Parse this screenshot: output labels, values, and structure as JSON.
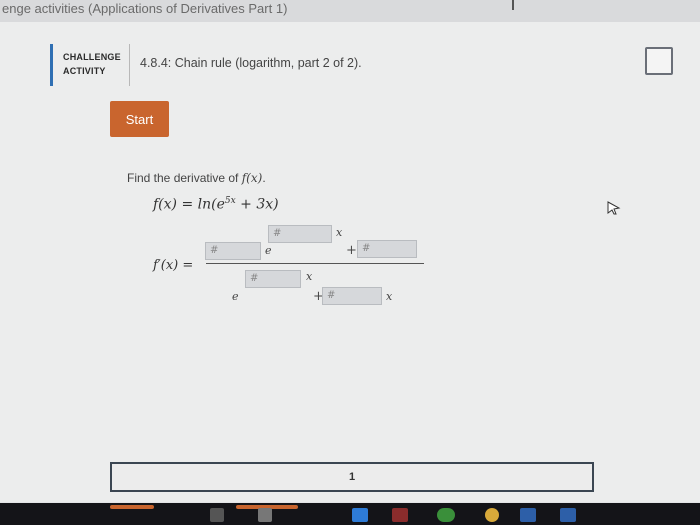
{
  "header": {
    "title": "enge activities (Applications of Derivatives Part 1)"
  },
  "activity": {
    "badge_line1": "CHALLENGE",
    "badge_line2": "ACTIVITY",
    "title": "4.8.4: Chain rule (logarithm, part 2 of 2)."
  },
  "start_label": "Start",
  "problem": {
    "prompt": "Find the derivative of ",
    "prompt_func": "f(x)",
    "prompt_end": ".",
    "func_lhs": "f(x) = ln(e",
    "func_exp": "5x",
    "func_rhs": " + 3x)",
    "deriv_label": "f′(x) ="
  },
  "blanks": {
    "placeholder": "#",
    "num_coef": "#",
    "num_exp_coef": "#",
    "num_const": "#",
    "den_coef": "#",
    "den_const": "#"
  },
  "symbols": {
    "e": "e",
    "x": "x",
    "plus": "+"
  },
  "progress": {
    "current_step": "1"
  },
  "colors": {
    "accent": "#2f6fb3",
    "start_button": "#c9652e"
  }
}
